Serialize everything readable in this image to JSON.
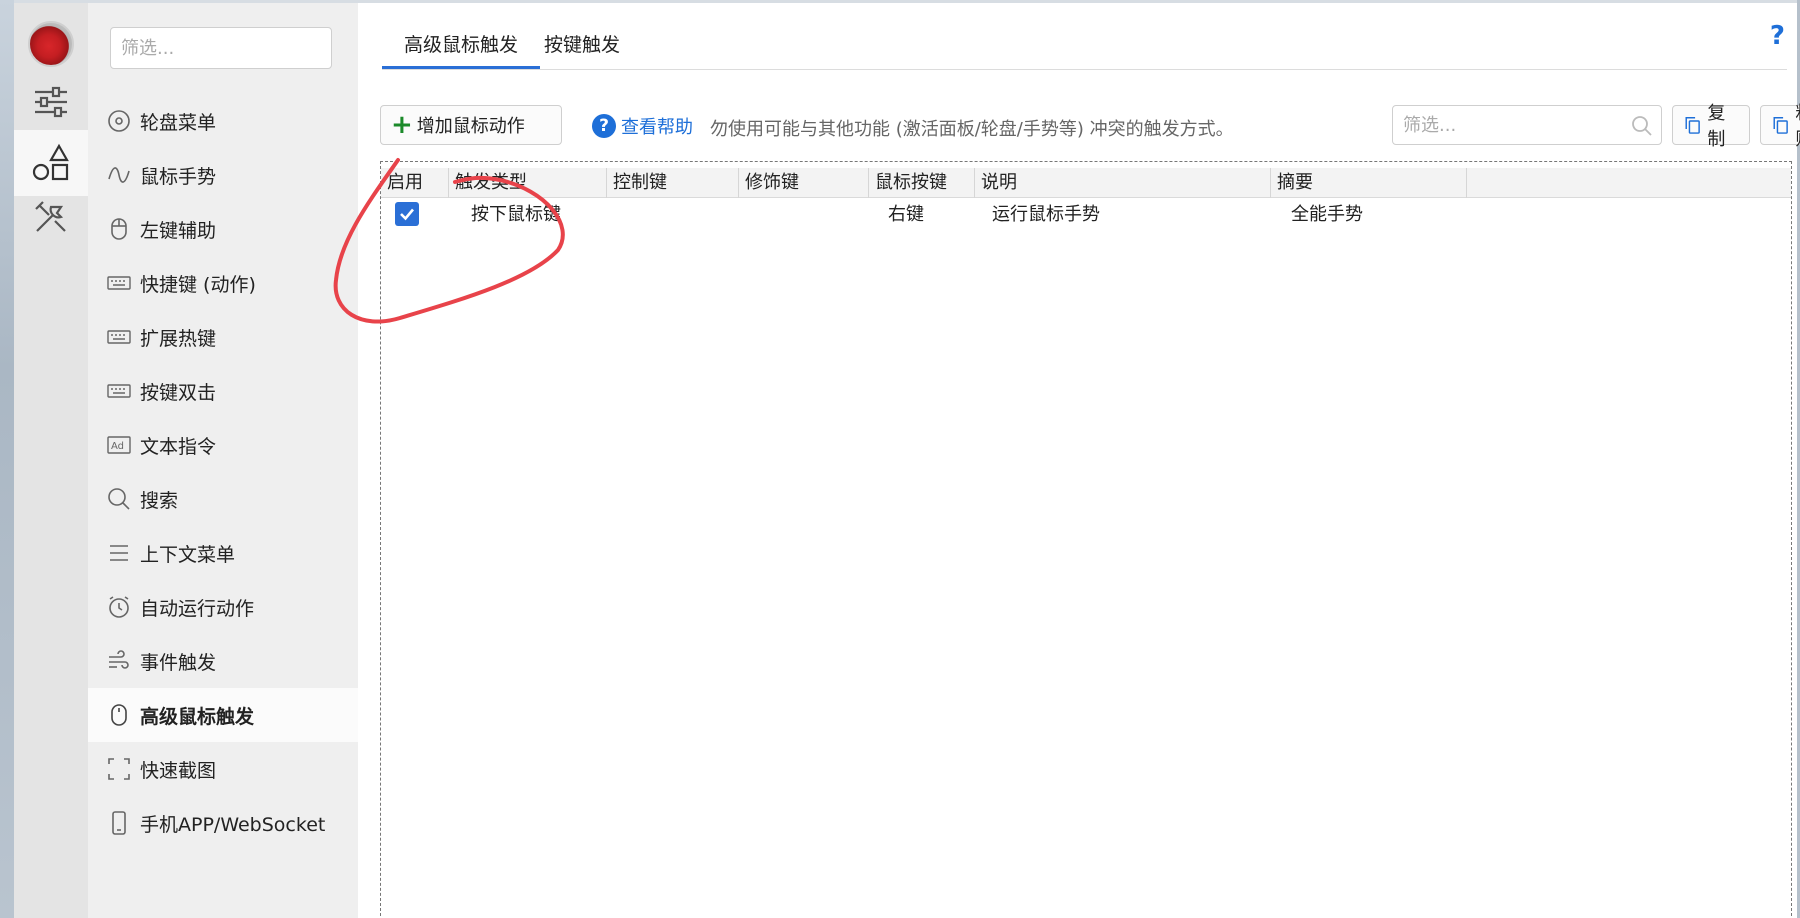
{
  "sidebar_rail": {
    "items": [
      {
        "icon": "sliders-icon"
      },
      {
        "icon": "shapes-icon",
        "active": true
      },
      {
        "icon": "tools-icon"
      }
    ]
  },
  "nav": {
    "filter_placeholder": "筛选...",
    "items": [
      {
        "label": "轮盘菜单",
        "icon": "wheel-icon"
      },
      {
        "label": "鼠标手势",
        "icon": "gesture-icon"
      },
      {
        "label": "左键辅助",
        "icon": "mouse-icon"
      },
      {
        "label": "快捷键 (动作)",
        "icon": "keyboard-icon"
      },
      {
        "label": "扩展热键",
        "icon": "keyboard-icon"
      },
      {
        "label": "按键双击",
        "icon": "keyboard-icon"
      },
      {
        "label": "文本指令",
        "icon": "ad-icon"
      },
      {
        "label": "搜索",
        "icon": "search-icon"
      },
      {
        "label": "上下文菜单",
        "icon": "menu-icon"
      },
      {
        "label": "自动运行动作",
        "icon": "alarm-icon"
      },
      {
        "label": "事件触发",
        "icon": "wind-icon"
      },
      {
        "label": "高级鼠标触发",
        "icon": "mouse-icon",
        "active": true
      },
      {
        "label": "快速截图",
        "icon": "screenshot-icon"
      },
      {
        "label": "手机APP/WebSocket",
        "icon": "phone-icon"
      }
    ]
  },
  "tabs": [
    {
      "label": "高级鼠标触发",
      "active": true
    },
    {
      "label": "按键触发",
      "active": false
    }
  ],
  "help_mark": "?",
  "toolbar": {
    "add_button": "增加鼠标动作",
    "add_icon": "plus-icon",
    "help_link": "查看帮助",
    "hint": "勿使用可能与其他功能 (激活面板/轮盘/手势等) 冲突的触发方式。",
    "filter_placeholder": "筛选...",
    "copy_button": "复制",
    "paste_button": "粘贴"
  },
  "table": {
    "columns": [
      "启用",
      "触发类型",
      "控制键",
      "修饰键",
      "鼠标按键",
      "说明",
      "摘要"
    ],
    "rows": [
      {
        "enabled": true,
        "trigger_type": "按下鼠标键",
        "control_key": "",
        "modifier_key": "",
        "mouse_button": "右键",
        "description": "运行鼠标手势",
        "summary": "全能手势"
      }
    ]
  },
  "colors": {
    "accent": "#2a6fd6",
    "add_plus": "#1b8a2a",
    "annotation": "#e8434a"
  }
}
